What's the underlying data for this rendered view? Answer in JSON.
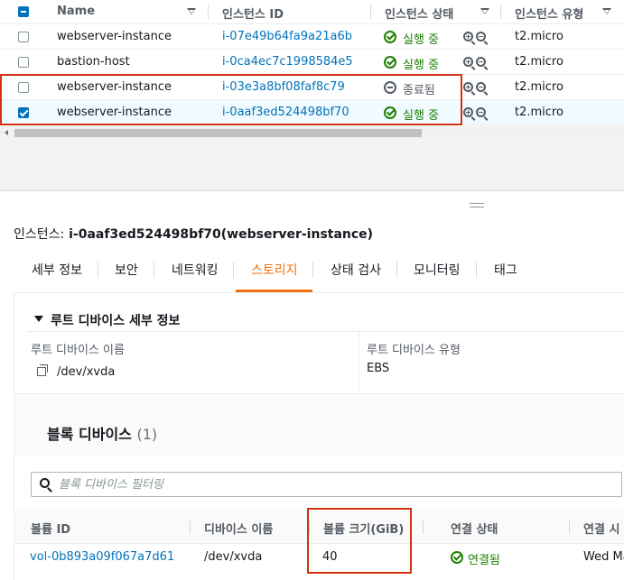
{
  "instances_table": {
    "columns": [
      "Name",
      "인스턴스 ID",
      "인스턴스 상태",
      "인스턴스 유형"
    ],
    "rows": [
      {
        "name": "webserver-instance",
        "id": "i-07e49b64fa9a21a6b",
        "state": "실행 중",
        "type": "t2.micro",
        "selected": false
      },
      {
        "name": "bastion-host",
        "id": "i-0ca4ec7c1998584e5",
        "state": "실행 중",
        "type": "t2.micro",
        "selected": false
      },
      {
        "name": "webserver-instance",
        "id": "i-03e3a8bf08faf8c79",
        "state": "종료됨",
        "type": "t2.micro",
        "selected": false
      },
      {
        "name": "webserver-instance",
        "id": "i-0aaf3ed524498bf70",
        "state": "실행 중",
        "type": "t2.micro",
        "selected": true
      }
    ]
  },
  "details": {
    "label": "인스턴스:",
    "value": "i-0aaf3ed524498bf70(webserver-instance)",
    "tabs": [
      "세부 정보",
      "보안",
      "네트워킹",
      "스토리지",
      "상태 검사",
      "모니터링",
      "태그"
    ],
    "active_tab": "스토리지"
  },
  "root_device": {
    "section_title": "루트 디바이스 세부 정보",
    "name_label": "루트 디바이스 이름",
    "name_value": "/dev/xvda",
    "type_label": "루트 디바이스 유형",
    "type_value": "EBS"
  },
  "block_devices": {
    "title": "블록 디바이스",
    "count": "(1)",
    "filter_placeholder": "블록 디바이스 필터링",
    "columns": [
      "볼륨 ID",
      "디바이스 이름",
      "볼륨 크기(GiB)",
      "연결 상태",
      "연결 시"
    ],
    "rows": [
      {
        "volume_id": "vol-0b893a09f067a7d61",
        "device": "/dev/xvda",
        "size": "40",
        "status": "연결됨",
        "time": "Wed Ma"
      }
    ]
  },
  "colors": {
    "link": "#0073bb",
    "running": "#1d8102",
    "active_tab": "#ec7211",
    "highlight": "#d13212"
  }
}
